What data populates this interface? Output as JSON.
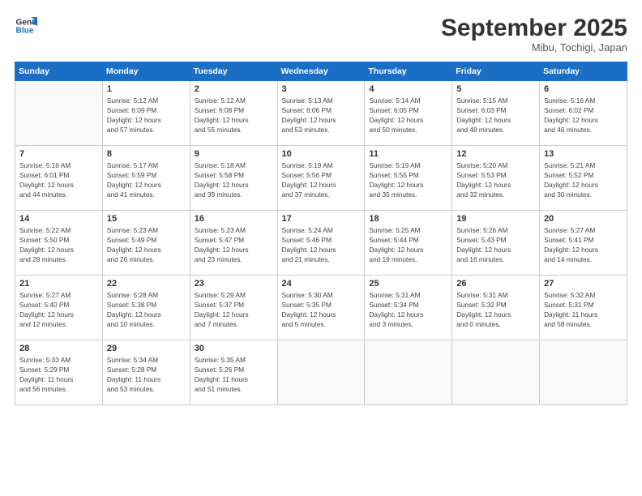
{
  "logo": {
    "line1": "General",
    "line2": "Blue"
  },
  "header": {
    "month": "September 2025",
    "location": "Mibu, Tochigi, Japan"
  },
  "weekdays": [
    "Sunday",
    "Monday",
    "Tuesday",
    "Wednesday",
    "Thursday",
    "Friday",
    "Saturday"
  ],
  "weeks": [
    [
      {
        "day": "",
        "info": ""
      },
      {
        "day": "1",
        "info": "Sunrise: 5:12 AM\nSunset: 6:09 PM\nDaylight: 12 hours\nand 57 minutes."
      },
      {
        "day": "2",
        "info": "Sunrise: 5:12 AM\nSunset: 6:08 PM\nDaylight: 12 hours\nand 55 minutes."
      },
      {
        "day": "3",
        "info": "Sunrise: 5:13 AM\nSunset: 6:06 PM\nDaylight: 12 hours\nand 53 minutes."
      },
      {
        "day": "4",
        "info": "Sunrise: 5:14 AM\nSunset: 6:05 PM\nDaylight: 12 hours\nand 50 minutes."
      },
      {
        "day": "5",
        "info": "Sunrise: 5:15 AM\nSunset: 6:03 PM\nDaylight: 12 hours\nand 48 minutes."
      },
      {
        "day": "6",
        "info": "Sunrise: 5:16 AM\nSunset: 6:02 PM\nDaylight: 12 hours\nand 46 minutes."
      }
    ],
    [
      {
        "day": "7",
        "info": "Sunrise: 5:16 AM\nSunset: 6:01 PM\nDaylight: 12 hours\nand 44 minutes."
      },
      {
        "day": "8",
        "info": "Sunrise: 5:17 AM\nSunset: 5:59 PM\nDaylight: 12 hours\nand 41 minutes."
      },
      {
        "day": "9",
        "info": "Sunrise: 5:18 AM\nSunset: 5:58 PM\nDaylight: 12 hours\nand 39 minutes."
      },
      {
        "day": "10",
        "info": "Sunrise: 5:19 AM\nSunset: 5:56 PM\nDaylight: 12 hours\nand 37 minutes."
      },
      {
        "day": "11",
        "info": "Sunrise: 5:19 AM\nSunset: 5:55 PM\nDaylight: 12 hours\nand 35 minutes."
      },
      {
        "day": "12",
        "info": "Sunrise: 5:20 AM\nSunset: 5:53 PM\nDaylight: 12 hours\nand 32 minutes."
      },
      {
        "day": "13",
        "info": "Sunrise: 5:21 AM\nSunset: 5:52 PM\nDaylight: 12 hours\nand 30 minutes."
      }
    ],
    [
      {
        "day": "14",
        "info": "Sunrise: 5:22 AM\nSunset: 5:50 PM\nDaylight: 12 hours\nand 28 minutes."
      },
      {
        "day": "15",
        "info": "Sunrise: 5:23 AM\nSunset: 5:49 PM\nDaylight: 12 hours\nand 26 minutes."
      },
      {
        "day": "16",
        "info": "Sunrise: 5:23 AM\nSunset: 5:47 PM\nDaylight: 12 hours\nand 23 minutes."
      },
      {
        "day": "17",
        "info": "Sunrise: 5:24 AM\nSunset: 5:46 PM\nDaylight: 12 hours\nand 21 minutes."
      },
      {
        "day": "18",
        "info": "Sunrise: 5:25 AM\nSunset: 5:44 PM\nDaylight: 12 hours\nand 19 minutes."
      },
      {
        "day": "19",
        "info": "Sunrise: 5:26 AM\nSunset: 5:43 PM\nDaylight: 12 hours\nand 16 minutes."
      },
      {
        "day": "20",
        "info": "Sunrise: 5:27 AM\nSunset: 5:41 PM\nDaylight: 12 hours\nand 14 minutes."
      }
    ],
    [
      {
        "day": "21",
        "info": "Sunrise: 5:27 AM\nSunset: 5:40 PM\nDaylight: 12 hours\nand 12 minutes."
      },
      {
        "day": "22",
        "info": "Sunrise: 5:28 AM\nSunset: 5:38 PM\nDaylight: 12 hours\nand 10 minutes."
      },
      {
        "day": "23",
        "info": "Sunrise: 5:29 AM\nSunset: 5:37 PM\nDaylight: 12 hours\nand 7 minutes."
      },
      {
        "day": "24",
        "info": "Sunrise: 5:30 AM\nSunset: 5:35 PM\nDaylight: 12 hours\nand 5 minutes."
      },
      {
        "day": "25",
        "info": "Sunrise: 5:31 AM\nSunset: 5:34 PM\nDaylight: 12 hours\nand 3 minutes."
      },
      {
        "day": "26",
        "info": "Sunrise: 5:31 AM\nSunset: 5:32 PM\nDaylight: 12 hours\nand 0 minutes."
      },
      {
        "day": "27",
        "info": "Sunrise: 5:32 AM\nSunset: 5:31 PM\nDaylight: 11 hours\nand 58 minutes."
      }
    ],
    [
      {
        "day": "28",
        "info": "Sunrise: 5:33 AM\nSunset: 5:29 PM\nDaylight: 11 hours\nand 56 minutes."
      },
      {
        "day": "29",
        "info": "Sunrise: 5:34 AM\nSunset: 5:28 PM\nDaylight: 11 hours\nand 53 minutes."
      },
      {
        "day": "30",
        "info": "Sunrise: 5:35 AM\nSunset: 5:26 PM\nDaylight: 11 hours\nand 51 minutes."
      },
      {
        "day": "",
        "info": ""
      },
      {
        "day": "",
        "info": ""
      },
      {
        "day": "",
        "info": ""
      },
      {
        "day": "",
        "info": ""
      }
    ]
  ]
}
